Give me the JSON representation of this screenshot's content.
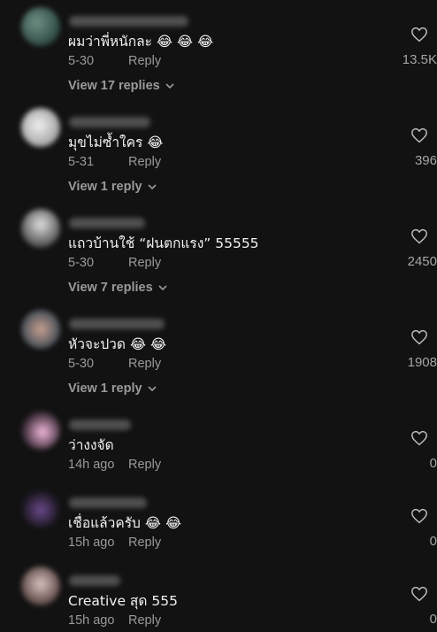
{
  "reply_label": "Reply",
  "comments": [
    {
      "text": "ผมว่าพี่หนักละ 😂 😂 😂",
      "time": "5-30",
      "likes": "13.5K",
      "view_replies": "View 17 replies",
      "avatar_color": "#4a6b62"
    },
    {
      "text": "มุขไม่ซ้ำใคร 😂",
      "time": "5-31",
      "likes": "396",
      "view_replies": "View 1 reply",
      "avatar_color": "#d8d8d8"
    },
    {
      "text": "แถวบ้านใช้ “ฝนตกแรง” 55555",
      "time": "5-30",
      "likes": "2450",
      "view_replies": "View 7 replies",
      "avatar_color": "#bdbdbd"
    },
    {
      "text": "หัวจะปวด 😂 😂",
      "time": "5-30",
      "likes": "1908",
      "view_replies": "View 1 reply",
      "avatar_color": "#8a6d6a"
    },
    {
      "text": "ว่างงจัด",
      "time": "14h ago",
      "likes": "0",
      "view_replies": "",
      "avatar_color": "#c77aa8"
    },
    {
      "text": "เชื่อแล้วครับ 😂 😂",
      "time": "15h ago",
      "likes": "0",
      "view_replies": "",
      "avatar_color": "#2a2230"
    },
    {
      "text": "Creative สุด 555",
      "time": "15h ago",
      "likes": "0",
      "view_replies": "",
      "avatar_color": "#7d6b6b"
    }
  ]
}
